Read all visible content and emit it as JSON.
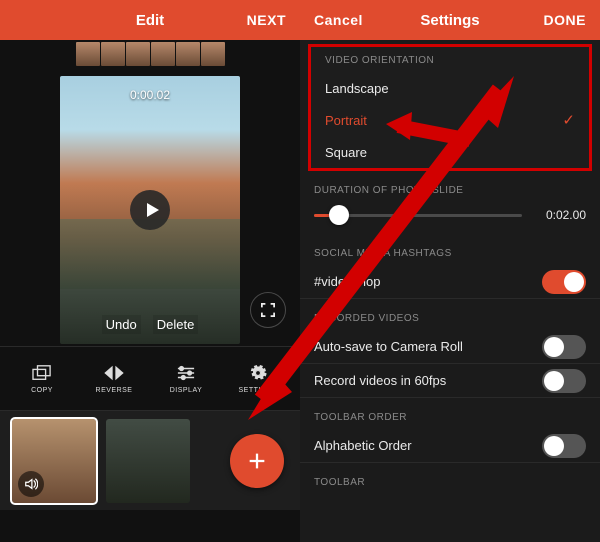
{
  "colors": {
    "accent": "#e04b2e",
    "highlight_border": "#d20000"
  },
  "left": {
    "title": "Edit",
    "next": "NEXT",
    "timestamp": "0:00.02",
    "undo": "Undo",
    "delete": "Delete",
    "icons": {
      "play": "play-icon",
      "fullscreen": "fullscreen-icon",
      "mute": "speaker-icon",
      "add": "plus-icon"
    },
    "toolbar": [
      {
        "name": "copy",
        "label": "COPY"
      },
      {
        "name": "reverse",
        "label": "REVERSE"
      },
      {
        "name": "display",
        "label": "DISPLAY"
      },
      {
        "name": "settings",
        "label": "SETTINGS"
      }
    ]
  },
  "right": {
    "cancel": "Cancel",
    "title": "Settings",
    "done": "DONE",
    "sections": {
      "orientation": {
        "title": "VIDEO ORIENTATION",
        "options": [
          "Landscape",
          "Portrait",
          "Square"
        ],
        "selected": "Portrait"
      },
      "duration": {
        "title": "DURATION OF PHOTO SLIDE",
        "value": "0:02.00"
      },
      "hashtags": {
        "title": "SOCIAL MEDIA HASHTAGS",
        "item": "#videoshop",
        "on": true
      },
      "recorded": {
        "title": "RECORDED VIDEOS",
        "items": [
          {
            "label": "Auto-save to Camera Roll",
            "on": false
          },
          {
            "label": "Record videos in 60fps",
            "on": false
          }
        ]
      },
      "toolbar_order": {
        "title": "TOOLBAR ORDER",
        "item": "Alphabetic Order",
        "on": false
      },
      "toolbar_section": {
        "title": "TOOLBAR"
      }
    }
  }
}
